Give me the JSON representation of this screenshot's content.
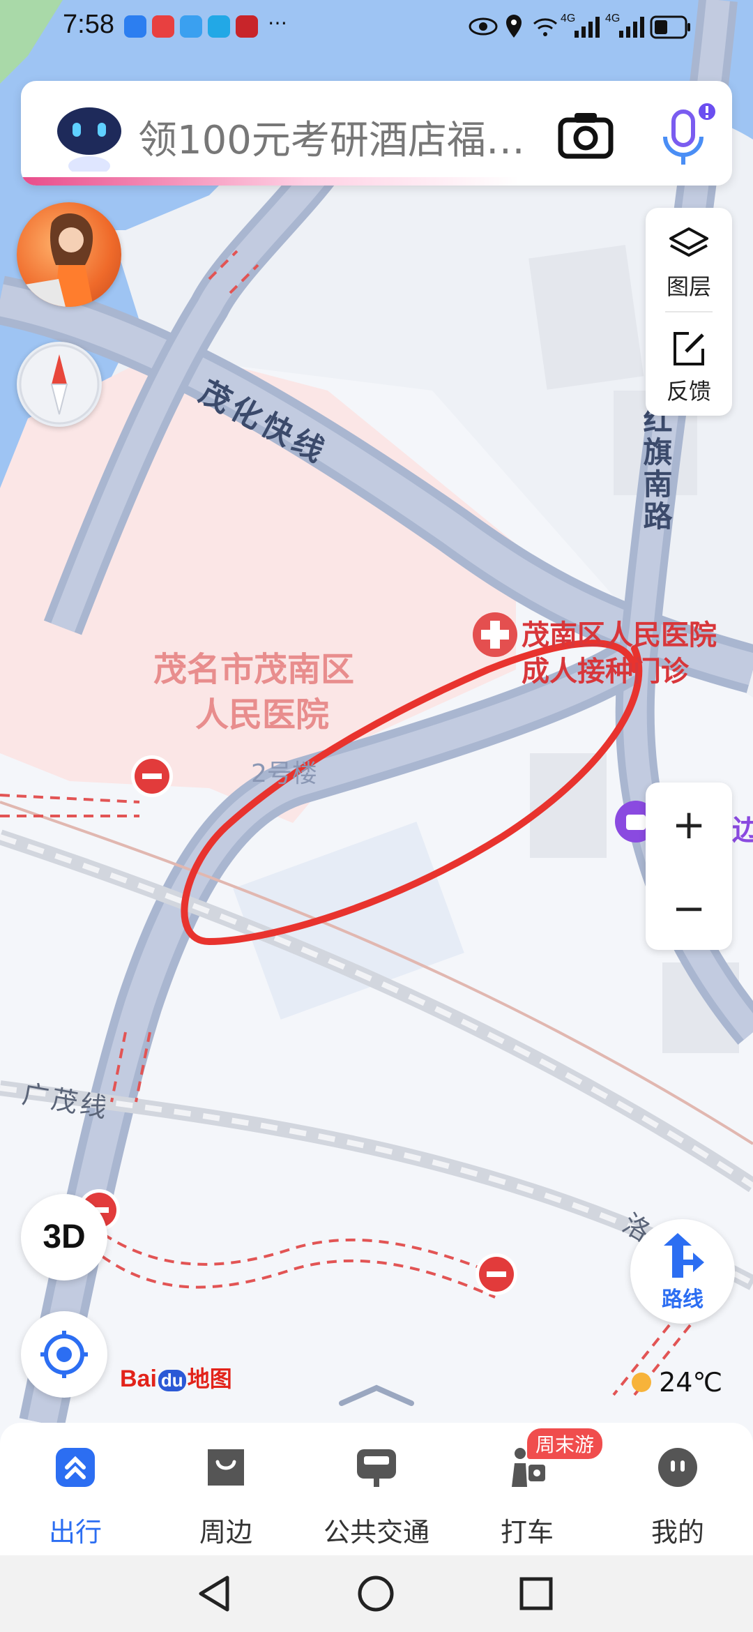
{
  "status_bar": {
    "time": "7:58",
    "net1": "4G",
    "net2": "4G"
  },
  "search": {
    "placeholder": "领100元考研酒店福…"
  },
  "tools": {
    "layers_label": "图层",
    "feedback_label": "反馈"
  },
  "map": {
    "roads": {
      "expressway": "茂化快线",
      "hongqi_south": "红旗南路",
      "guangmao_line": "广茂线",
      "partial_road": "洛"
    },
    "pois": {
      "hospital_area": "茂名市茂南区\n人民医院",
      "hospital_area_line1": "茂名市茂南区",
      "hospital_area_line2": "人民医院",
      "building": "2号楼",
      "clinic_line1": "茂南区人民医院",
      "clinic_line2": "成人接种门诊",
      "cut_off_poi": "一边"
    }
  },
  "controls": {
    "btn_3d": "3D",
    "route_label": "路线",
    "zoom_in": "+",
    "zoom_out": "−"
  },
  "weather": {
    "temperature": "24℃"
  },
  "logo": {
    "bai": "Bai",
    "du": "du",
    "ditu": "地图"
  },
  "bottom_nav": {
    "items": [
      {
        "label": "出行",
        "icon": "travel-icon",
        "active": true
      },
      {
        "label": "周边",
        "icon": "nearby-icon",
        "active": false
      },
      {
        "label": "公共交通",
        "icon": "bus-icon",
        "active": false
      },
      {
        "label": "打车",
        "icon": "taxi-icon",
        "active": false
      },
      {
        "label": "我的",
        "icon": "profile-icon",
        "active": false
      }
    ],
    "taxi_badge": "周末游"
  },
  "colors": {
    "accent": "#2c6ef2",
    "annotation_circle": "#e8332e",
    "hospital_fill": "#fbe6e6",
    "road_fill": "#a9b6d0"
  }
}
